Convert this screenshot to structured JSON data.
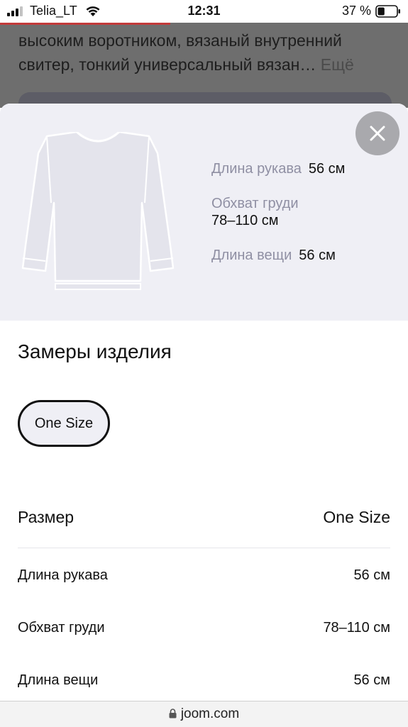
{
  "status_bar": {
    "carrier": "Telia_LT",
    "time": "12:31",
    "battery_percent": "37 %",
    "battery_level": 0.37,
    "icons": [
      "signal-icon",
      "wifi-icon",
      "battery-icon"
    ]
  },
  "background_page": {
    "description_line1": "высоким воротником, вязаный внутренний",
    "description_line2": "свитер, тонкий универсальный вязан…",
    "more_label": "Ещё"
  },
  "sheet": {
    "close_icon": "close-icon",
    "illustration_icon": "sweater-icon",
    "measurements": {
      "sleeve_label": "Длина рукава",
      "sleeve_value": "56 см",
      "chest_label": "Обхват груди",
      "chest_value": "78–110 см",
      "length_label": "Длина вещи",
      "length_value": "56 см"
    },
    "section_title": "Замеры изделия",
    "size_chip": "One Size",
    "table": {
      "header_left": "Размер",
      "header_right": "One Size",
      "rows": [
        {
          "label": "Длина рукава",
          "value": "56 см"
        },
        {
          "label": "Обхват груди",
          "value": "78–110 см"
        },
        {
          "label": "Длина вещи",
          "value": "56 см"
        }
      ]
    }
  },
  "browser": {
    "url": "joom.com",
    "lock_icon": "lock-icon"
  },
  "colors": {
    "sheet_hero_bg": "#efeff5",
    "label_gray": "#8f8fa3",
    "close_button_bg": "#a9a9ad",
    "overlay_dim": "#6e6e6e"
  }
}
